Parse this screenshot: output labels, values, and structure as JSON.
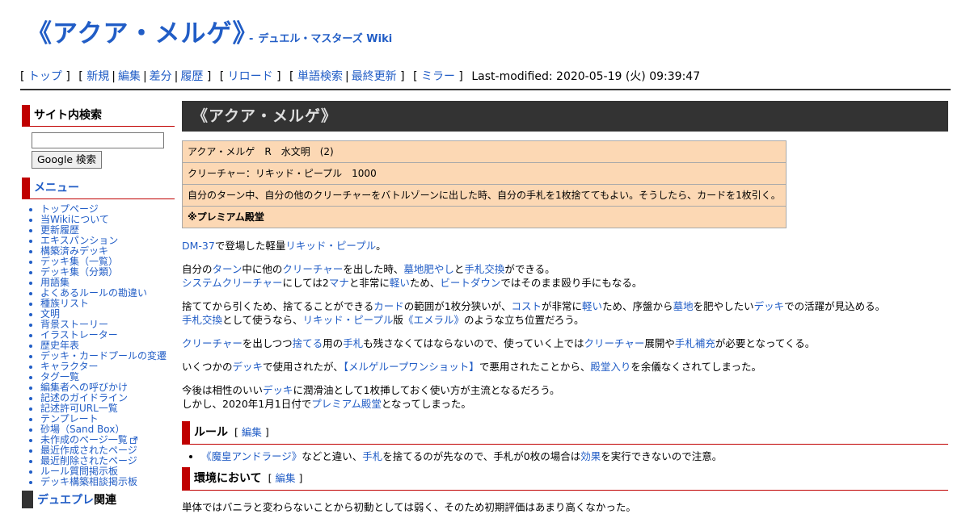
{
  "header": {
    "title": "《アクア・メルゲ》",
    "site_dash": "-",
    "site_name": "デュエル・マスターズ Wiki"
  },
  "navigator": {
    "top": "トップ",
    "new": "新規",
    "edit": "編集",
    "diff": "差分",
    "history": "履歴",
    "reload": "リロード",
    "word_search": "単語検索",
    "recent": "最終更新",
    "mirror": "ミラー",
    "last_modified": "Last-modified: 2020-05-19 (火) 09:39:47"
  },
  "sidebar": {
    "search_heading": "サイト内検索",
    "search_button": "Google 検索",
    "menu_heading": "メニュー",
    "items": [
      "トップページ",
      "当Wikiについて",
      "更新履歴",
      "エキスパンション",
      "構築済みデッキ",
      "デッキ集（一覧）",
      "デッキ集（分類）",
      "用語集",
      "よくあるルールの勘違い",
      "種族リスト",
      "文明",
      "背景ストーリー",
      "イラストレーター",
      "歴史年表",
      "デッキ・カードプールの変遷",
      "キャラクター",
      "タグ一覧",
      "編集者への呼びかけ",
      "記述のガイドライン",
      "記述許可URL一覧",
      "テンプレート",
      "砂場（Sand Box）",
      "未作成のページ一覧",
      "最近作成されたページ",
      "最近削除されたページ",
      "ルール質問掲示板",
      "デッキ構築相談掲示板"
    ],
    "dupre_link": "デュエプレ",
    "dupre_suffix": "関連"
  },
  "main": {
    "title": "《アクア・メルゲ》",
    "card": {
      "row1": "アクア・メルゲ　R　水文明　(2)",
      "row2": "クリーチャー：リキッド・ピープル　1000",
      "row3": "自分のターン中、自分の他のクリーチャーをバトルゾーンに出した時、自分の手札を1枚捨ててもよい。そうしたら、カードを1枚引く。",
      "row4": "※プレミアム殿堂"
    },
    "p1": {
      "a1": "DM-37",
      "t1": "で登場した軽量",
      "a2": "リキッド・ピープル",
      "t2": "。"
    },
    "p2": {
      "t1": "自分の",
      "a1": "ターン",
      "t2": "中に他の",
      "a2": "クリーチャー",
      "t3": "を出した時、",
      "a3": "墓地肥やし",
      "t4": "と",
      "a4": "手札交換",
      "t5": "ができる。",
      "a5": "システムクリーチャー",
      "t6": "にしては2",
      "a6": "マナ",
      "t7": "と非常に",
      "a7": "軽い",
      "t8": "ため、",
      "a8": "ビートダウン",
      "t9": "ではそのまま殴り手にもなる。"
    },
    "p3": {
      "t1": "捨ててから引くため、捨てることができる",
      "a1": "カード",
      "t2": "の範囲が1枚分狭いが、",
      "a2": "コスト",
      "t3": "が非常に",
      "a3": "軽い",
      "t4": "ため、序盤から",
      "a4": "墓地",
      "t5": "を肥やしたい",
      "a5": "デッキ",
      "t6": "での活躍が見込める。",
      "a6": "手札交換",
      "t7": "として使うなら、",
      "a7": "リキッド・ピープル",
      "t8": "版",
      "a8": "《エメラル》",
      "t9": "のような立ち位置だろう。"
    },
    "p4": {
      "a1": "クリーチャー",
      "t1": "を出しつつ",
      "a2": "捨てる",
      "t2": "用の",
      "a3": "手札",
      "t3": "も残さなくてはならないので、使っていく上では",
      "a4": "クリーチャー",
      "t4": "展開や",
      "a5": "手札補充",
      "t5": "が必要となってくる。"
    },
    "p5": {
      "t1": "いくつかの",
      "a1": "デッキ",
      "t2": "で使用されたが、",
      "a2": "【メルゲループワンショット】",
      "t3": "で悪用されたことから、",
      "a3": "殿堂入り",
      "t4": "を余儀なくされてしまった。"
    },
    "p6": {
      "t1": "今後は相性のいい",
      "a1": "デッキ",
      "t2": "に潤滑油として1枚挿しておく使い方が主流となるだろう。",
      "t3": "しかし、2020年1月1日付で",
      "a2": "プレミアム殿堂",
      "t4": "となってしまった。"
    },
    "rule_heading": "ルール",
    "edit_label": "編集",
    "rule_item": {
      "a1": "《魔皇アンドラージ》",
      "t1": "などと違い、",
      "a2": "手札",
      "t2": "を捨てるのが先なので、手札が0枚の場合は",
      "a3": "効果",
      "t3": "を実行できないので注意。"
    },
    "env_heading": "環境において",
    "env_text": "単体ではバニラと変わらないことから初動としては弱く、そのため初期評価はあまり高くなかった。"
  },
  "colors": {
    "link": "#215dc6",
    "accent_red": "#c00000",
    "title_bar": "#333333",
    "card_bg": "#fcd8b4"
  }
}
